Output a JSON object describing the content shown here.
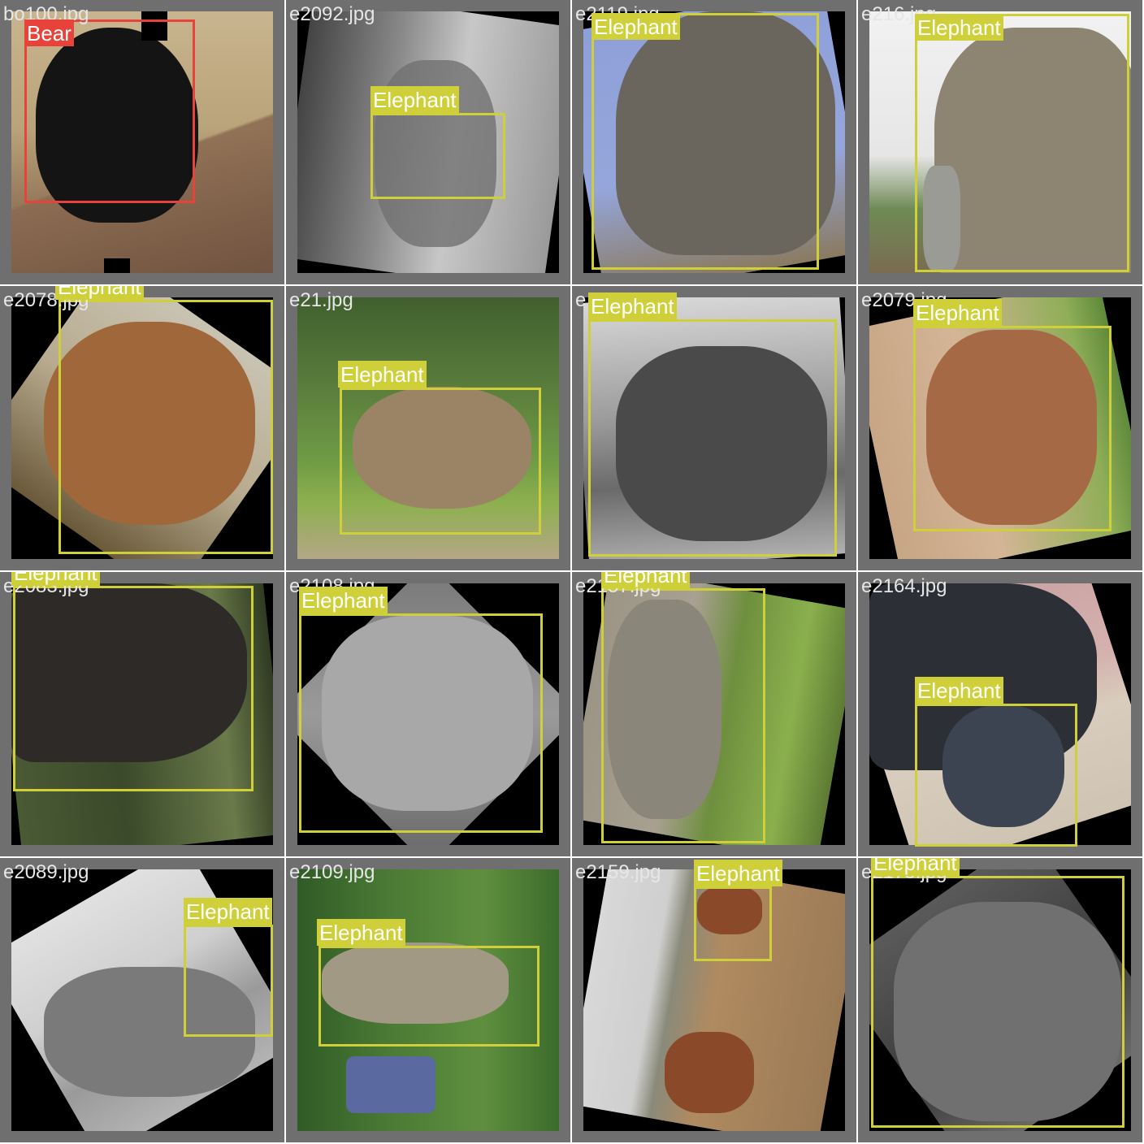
{
  "mosaic": {
    "cells": [
      {
        "filename": "bo100.jpg",
        "label": "Bear"
      },
      {
        "filename": "e2092.jpg",
        "label": "Elephant"
      },
      {
        "filename": "e2119.jpg",
        "label": "Elephant"
      },
      {
        "filename": "e216.jpg",
        "label": "Elephant"
      },
      {
        "filename": "e2078.jpg",
        "label": "Elephant"
      },
      {
        "filename": "e21.jpg",
        "label": "Elephant"
      },
      {
        "filename": "e",
        "label": "Elephant"
      },
      {
        "filename": "e2079.jpg",
        "label": "Elephant"
      },
      {
        "filename": "e2083.jpg",
        "label": "Elephant"
      },
      {
        "filename": "e2108.jpg",
        "label": "Elephant"
      },
      {
        "filename": "e2157.jpg",
        "label": "Elephant"
      },
      {
        "filename": "e2164.jpg",
        "label": "Elephant"
      },
      {
        "filename": "e2089.jpg",
        "label": "Elephant"
      },
      {
        "filename": "e2109.jpg",
        "label": "Elephant"
      },
      {
        "filename": "e2159.jpg",
        "label": "Elephant"
      },
      {
        "filename": "e2175.jpg",
        "label": "Elephant"
      }
    ]
  },
  "colors": {
    "tile_border": "#6f6f6f",
    "elephant_box": "#cfcf3a",
    "bear_box": "#e8433b",
    "filename_text": "#e6e6e6"
  }
}
